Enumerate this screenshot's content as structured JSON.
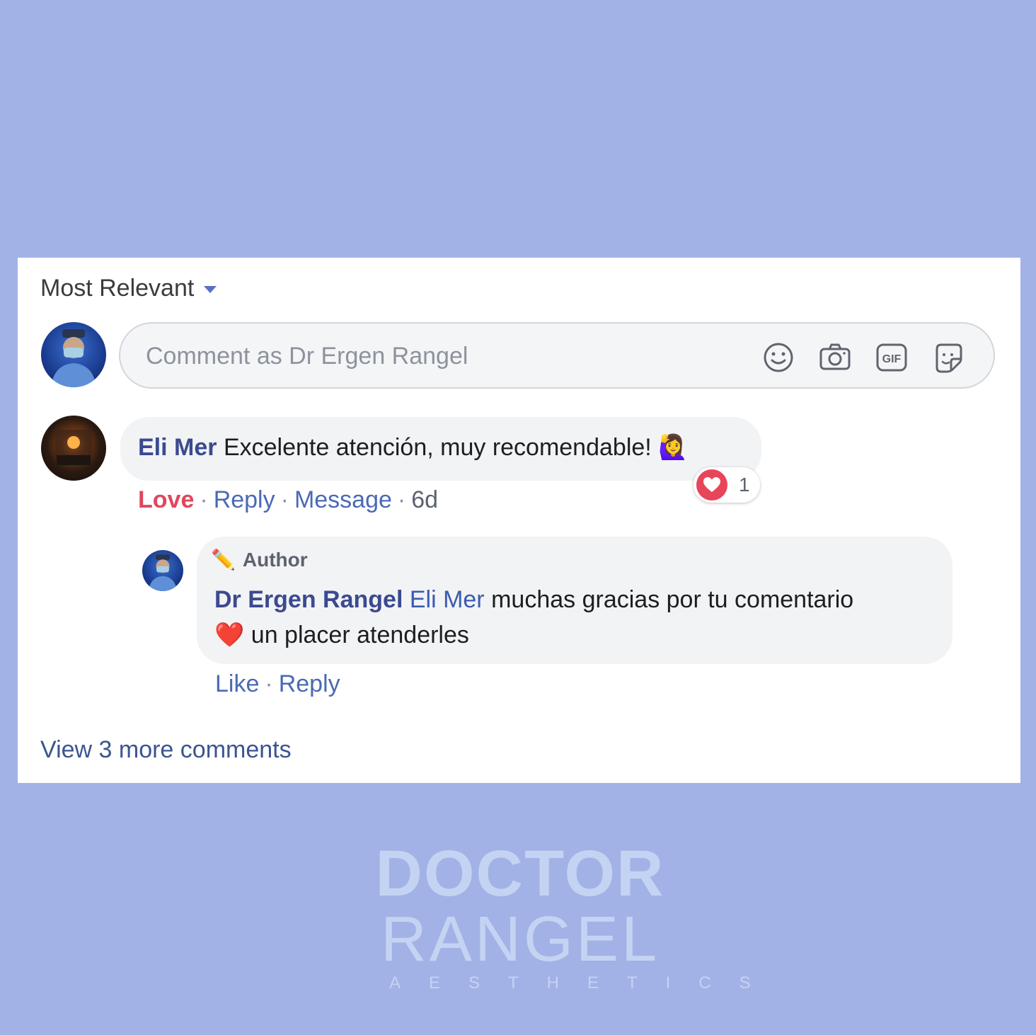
{
  "sort": {
    "label": "Most Relevant"
  },
  "composer": {
    "placeholder": "Comment as Dr Ergen Rangel",
    "icons": [
      "emoji-icon",
      "camera-icon",
      "gif-icon",
      "sticker-icon"
    ]
  },
  "comment": {
    "author": "Eli Mer",
    "text": "Excelente atención, muy recomendable!",
    "emoji": "🙋‍♀️",
    "actions": {
      "love": "Love",
      "reply": "Reply",
      "message": "Message",
      "time": "6d"
    },
    "reaction_count": "1"
  },
  "reply": {
    "badge": "Author",
    "badge_emoji": "✏️",
    "author": "Dr Ergen Rangel",
    "mention": "Eli Mer",
    "text_line1": "muchas gracias por tu comentario",
    "heart": "❤️",
    "text_line2": "un placer atenderles",
    "actions": {
      "like": "Like",
      "reply": "Reply"
    }
  },
  "view_more": "View 3 more comments",
  "logo": {
    "line1": "DOCTOR",
    "line2": "RANGEL",
    "line3": "AESTHETICS"
  },
  "colors": {
    "background": "#a2b2e6",
    "love": "#e0475e",
    "link": "#4a6ab4"
  }
}
